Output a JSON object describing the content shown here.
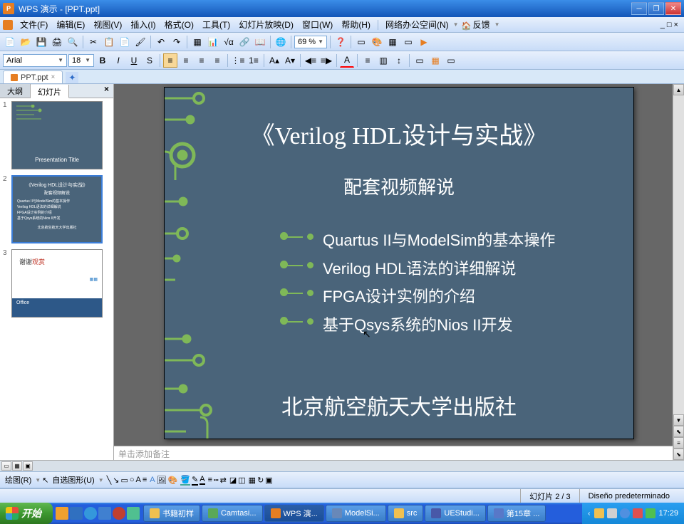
{
  "window": {
    "app_name": "WPS 演示",
    "doc_name": "[PPT.ppt]"
  },
  "menu": {
    "file": "文件(F)",
    "edit": "编辑(E)",
    "view": "视图(V)",
    "insert": "插入(I)",
    "format": "格式(O)",
    "tools": "工具(T)",
    "slideshow": "幻灯片放映(D)",
    "window": "窗口(W)",
    "help": "帮助(H)",
    "network": "网络办公空间(N)",
    "feedback": "反馈"
  },
  "sub_window_controls": "_ □ ×",
  "toolbar1": {
    "zoom": "69 %"
  },
  "toolbar2": {
    "font": "Arial",
    "size": "18",
    "bold": "B",
    "italic": "I",
    "underline": "U",
    "shadow": "S"
  },
  "doctab": {
    "name": "PPT.ppt"
  },
  "side": {
    "tab_outline": "大纲",
    "tab_slides": "幻灯片",
    "close": "×"
  },
  "thumbs": {
    "n1": "1",
    "n2": "2",
    "n3": "3",
    "t1_caption": "Presentation Title",
    "t2_title": "《Verilog HDL设计与实战》",
    "t2_sub": "配套视频解说",
    "t2_b1": "Quartus II与ModelSim的基本操作",
    "t2_b2": "Verilog HDL语法的详细解说",
    "t2_b3": "FPGA设计实例的介绍",
    "t2_b4": "基于Qsys系统的Nios II开发",
    "t2_foot": "北京航空航天大学出版社",
    "t3_text": "谢谢观赏",
    "t3_office": "Office"
  },
  "slide": {
    "title": "《Verilog HDL设计与实战》",
    "subtitle": "配套视频解说",
    "bullet1": "Quartus II与ModelSim的基本操作",
    "bullet2": "Verilog HDL语法的详细解说",
    "bullet3": "FPGA设计实例的介绍",
    "bullet4": "基于Qsys系统的Nios II开发",
    "footer": "北京航空航天大学出版社"
  },
  "notes_placeholder": "单击添加备注",
  "drawbar": {
    "draw": "绘图(R)",
    "autoshape": "自选图形(U)"
  },
  "status": {
    "slide_num": "幻灯片 2 / 3",
    "design": "Diseño predeterminado"
  },
  "taskbar": {
    "start": "开始",
    "items": [
      {
        "label": "书籍初样",
        "color": "#f0c050"
      },
      {
        "label": "Camtasi...",
        "color": "#5aa858"
      },
      {
        "label": "WPS 演...",
        "color": "#e67e22"
      },
      {
        "label": "ModelSi...",
        "color": "#6888b8"
      },
      {
        "label": "src",
        "color": "#f0c050"
      },
      {
        "label": "UEStudi...",
        "color": "#4858a8"
      },
      {
        "label": "第15章 ...",
        "color": "#5878c8"
      }
    ],
    "time": "17:29"
  },
  "colors": {
    "ql1": "#f0a030",
    "ql2": "#3070c0",
    "ql3": "#3498db",
    "ql4": "#4080d0",
    "ql5": "#c04030"
  }
}
